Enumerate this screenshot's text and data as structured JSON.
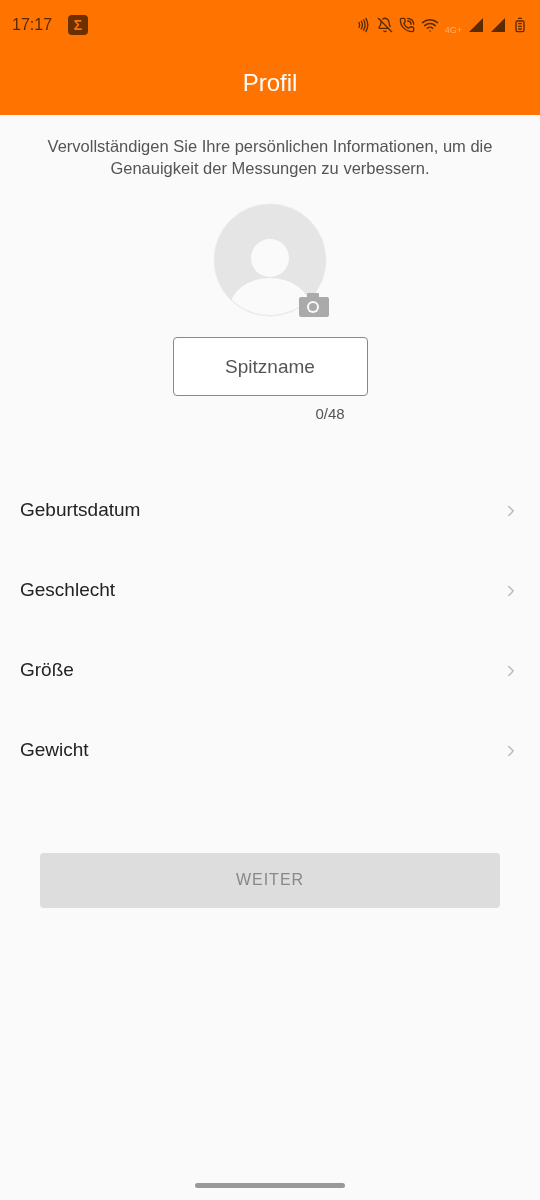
{
  "status_bar": {
    "time": "17:17",
    "app_glyph": "Σ",
    "network": "4G+"
  },
  "title": "Profil",
  "intro": "Vervollständigen Sie Ihre persönlichen Informationen, um die Genauigkeit der Messungen zu verbessern.",
  "nickname": {
    "placeholder": "Spitzname",
    "counter": "0/48"
  },
  "rows": [
    {
      "label": "Geburtsdatum"
    },
    {
      "label": "Geschlecht"
    },
    {
      "label": "Größe"
    },
    {
      "label": "Gewicht"
    }
  ],
  "next_button": {
    "label": "WEITER",
    "disabled": true
  }
}
